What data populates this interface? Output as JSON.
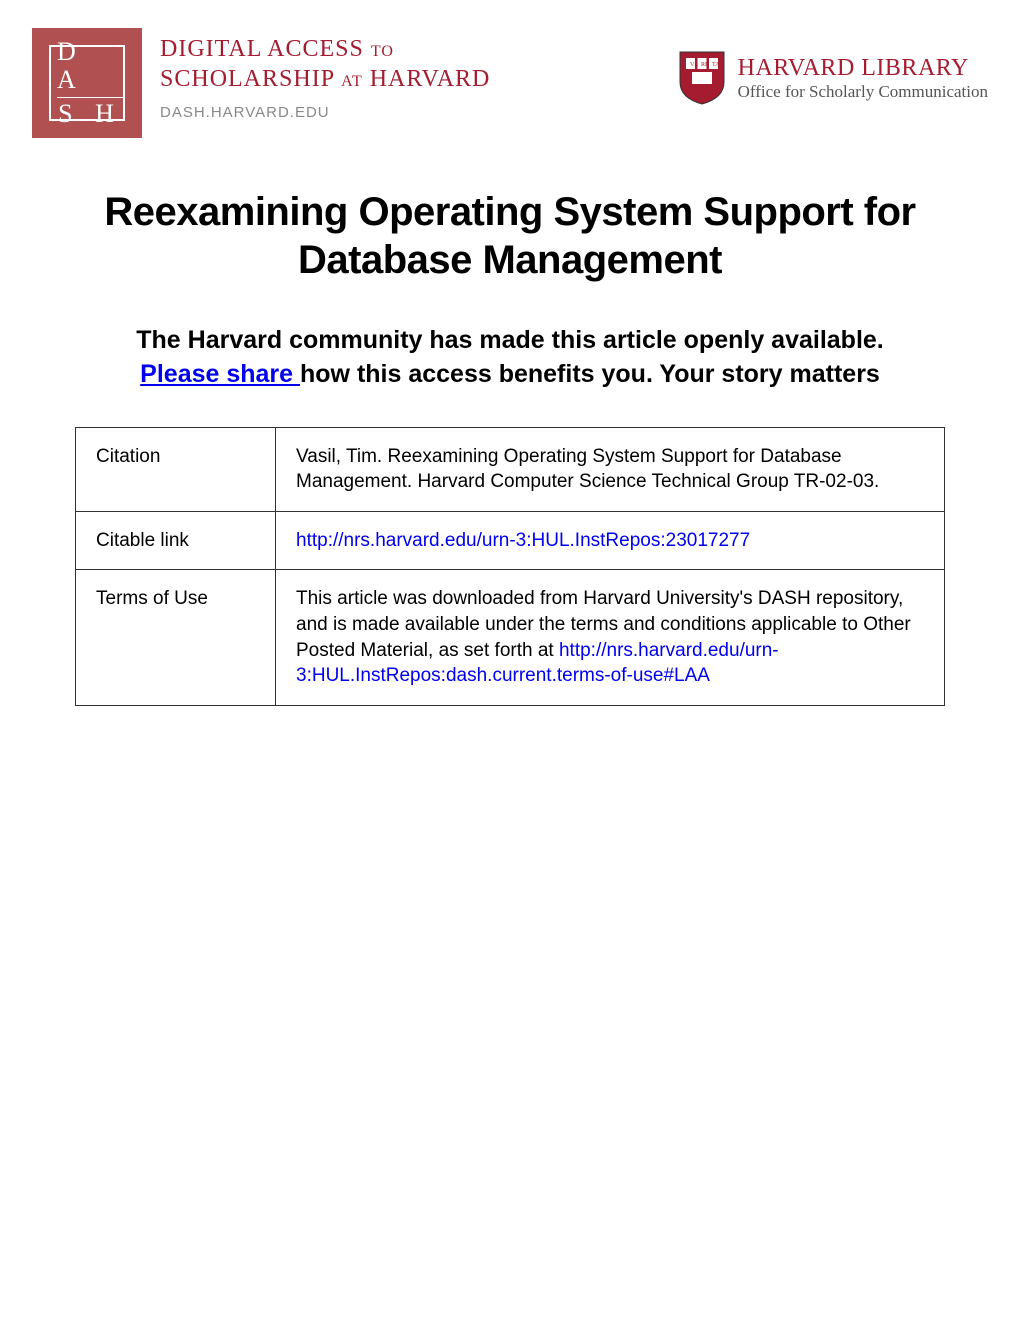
{
  "header": {
    "dash": {
      "logo_line1": "D A",
      "logo_line2": "S H",
      "title_line1_a": "DIGITAL ACCESS",
      "title_line1_b": "TO",
      "title_line2_a": "SCHOLARSHIP",
      "title_line2_b": "AT",
      "title_line2_c": "HARVARD",
      "url": "DASH.HARVARD.EDU"
    },
    "harvard": {
      "title": "HARVARD LIBRARY",
      "subtitle": "Office for Scholarly Communication"
    }
  },
  "title": "Reexamining Operating System Support for Database Management",
  "subtitle": {
    "part1": "The Harvard community has made this article openly available. ",
    "share_link": " Please share ",
    "part2": " how this access benefits you. Your story matters"
  },
  "table": {
    "citation": {
      "label": "Citation",
      "value": "Vasil, Tim. Reexamining Operating System Support for Database Management. Harvard Computer Science Technical Group TR-02-03."
    },
    "citable_link": {
      "label": "Citable link",
      "url": "http://nrs.harvard.edu/urn-3:HUL.InstRepos:23017277"
    },
    "terms": {
      "label": "Terms of Use",
      "text1": "This article was downloaded from Harvard University's DASH repository, and is made available under the terms and conditions applicable to Other Posted Material, as set forth at ",
      "url": "http://nrs.harvard.edu/urn-3:HUL.InstRepos:dash.current.terms-of-use#LAA"
    }
  }
}
